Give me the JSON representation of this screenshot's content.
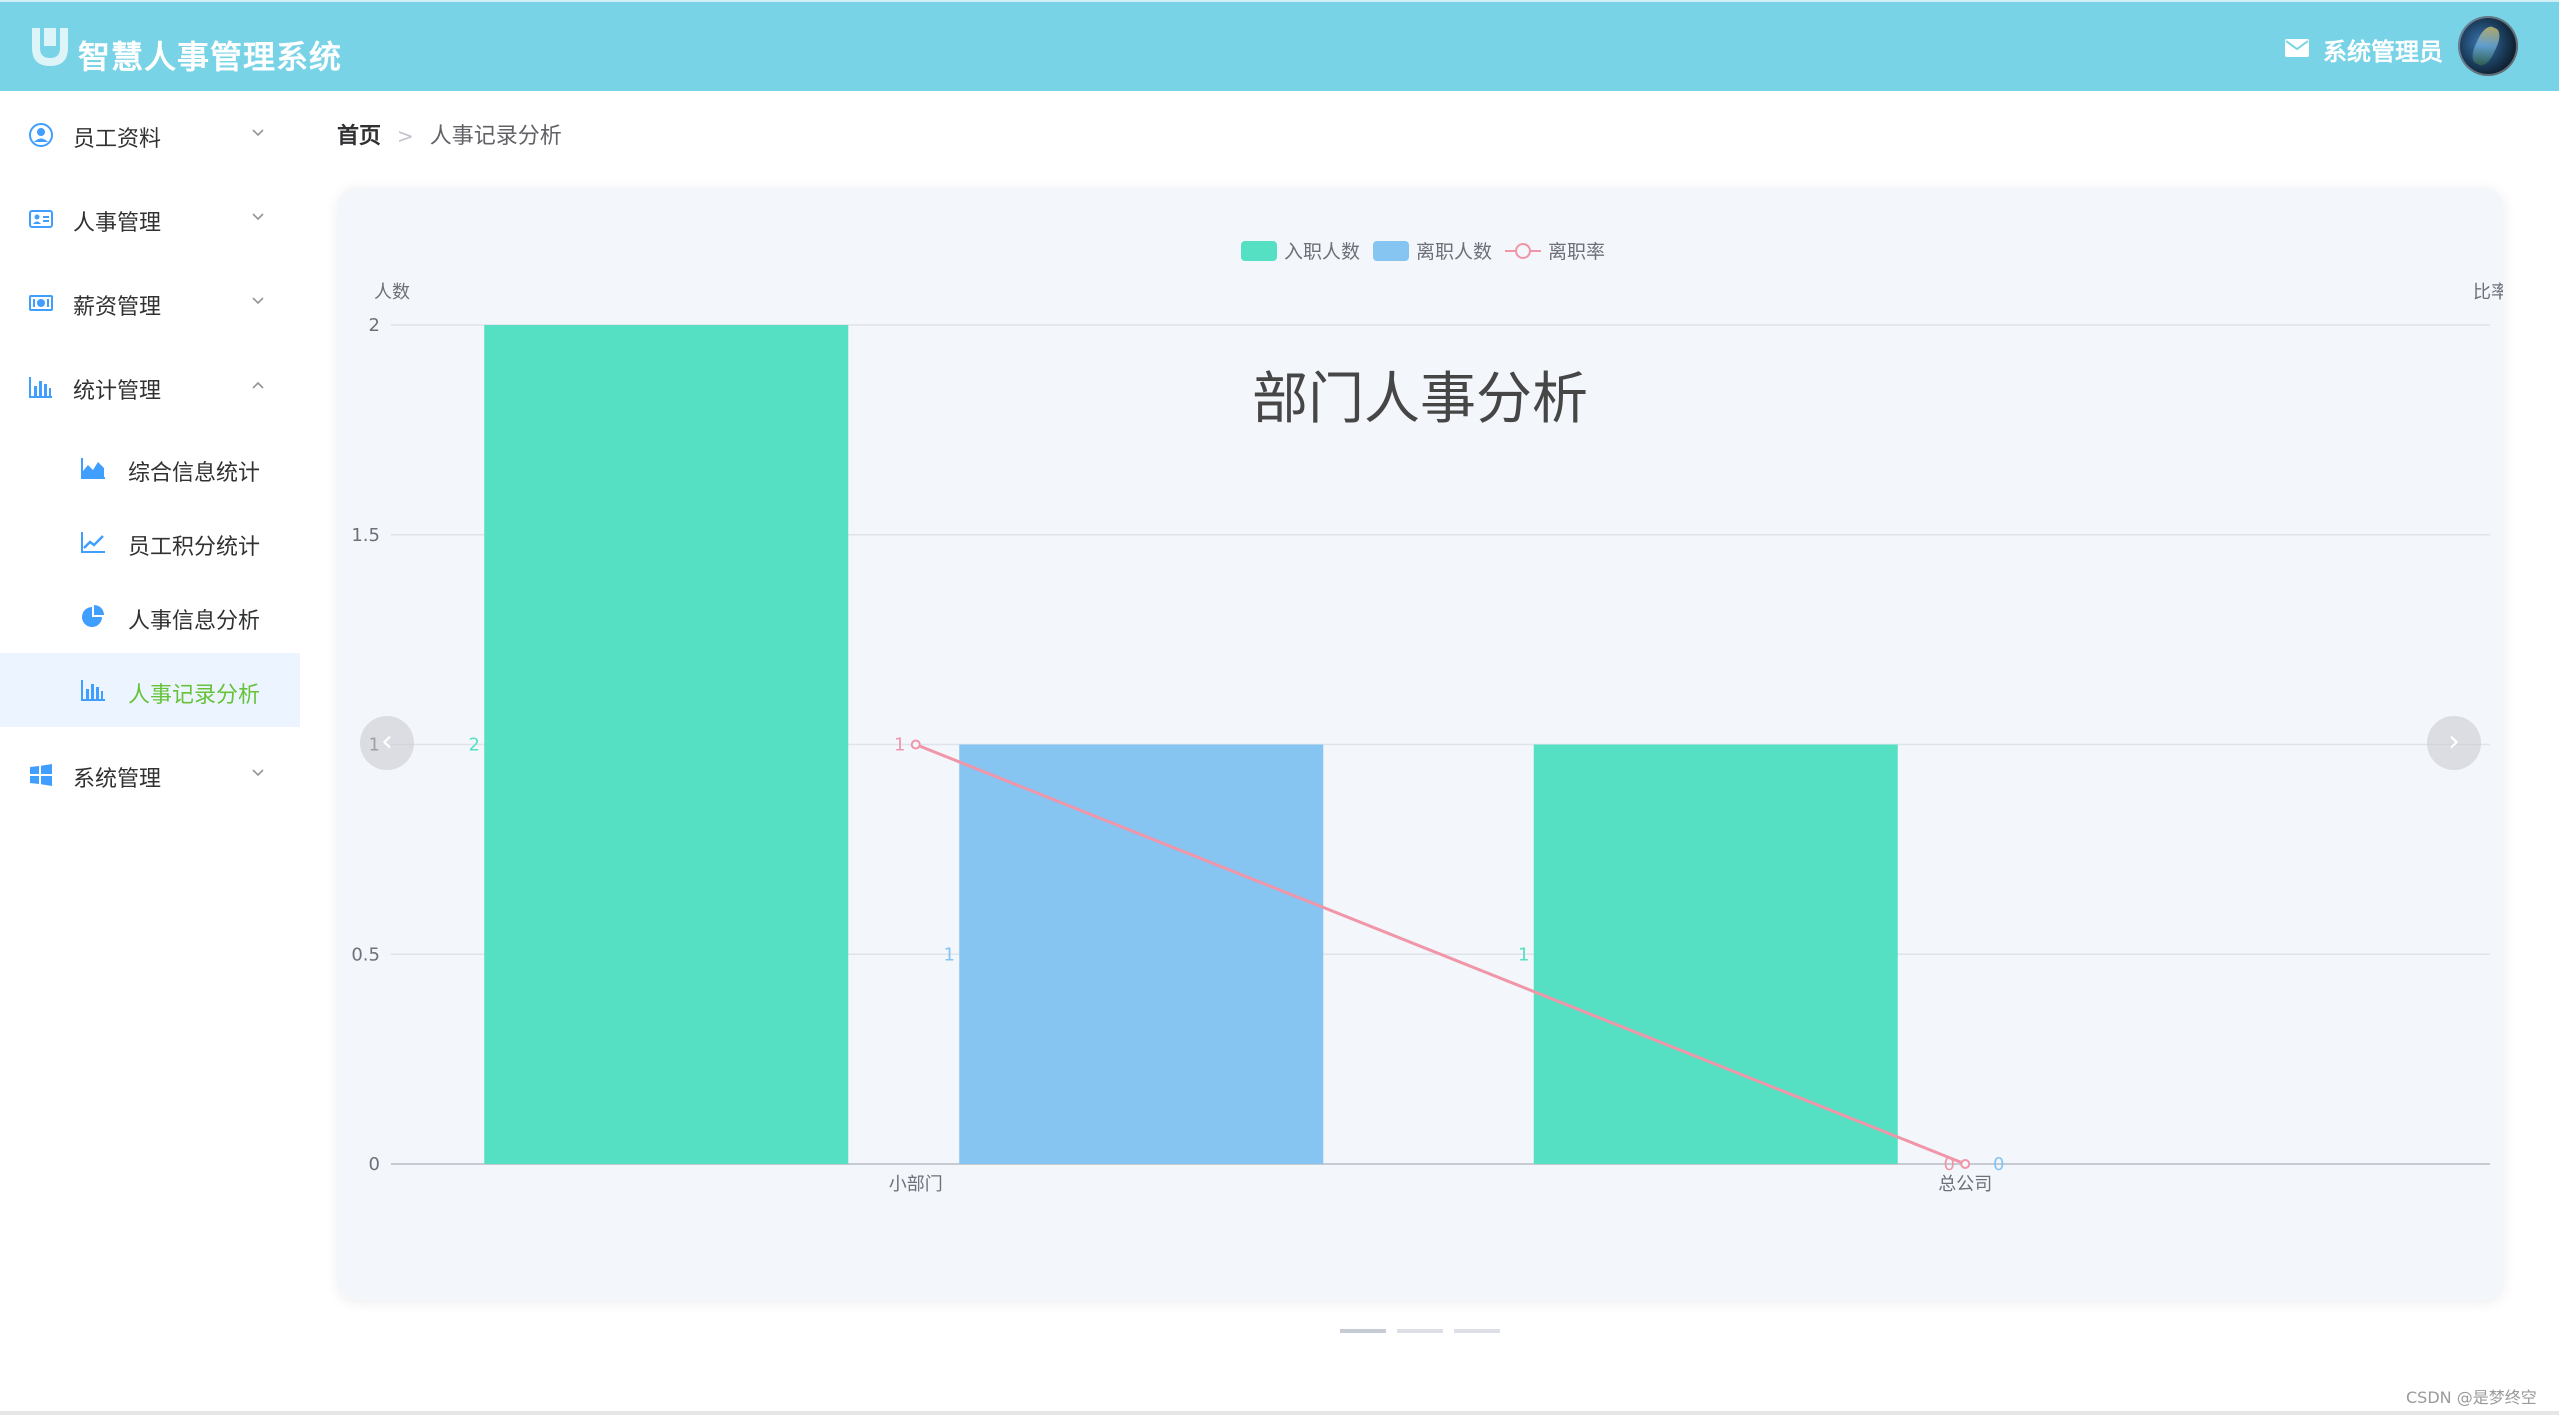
{
  "header": {
    "title": "智慧人事管理系统",
    "user": "系统管理员",
    "bg_color": "#78d3e6"
  },
  "sidebar": {
    "items": [
      {
        "label": "员工资料",
        "icon": "user-circle-icon",
        "expanded": false
      },
      {
        "label": "人事管理",
        "icon": "id-card-icon",
        "expanded": false
      },
      {
        "label": "薪资管理",
        "icon": "money-icon",
        "expanded": false
      },
      {
        "label": "统计管理",
        "icon": "bar-chart-icon",
        "expanded": true
      },
      {
        "label": "系统管理",
        "icon": "windows-icon",
        "expanded": false
      }
    ],
    "sub_items": [
      {
        "label": "综合信息统计",
        "icon": "area-chart-icon",
        "active": false
      },
      {
        "label": "员工积分统计",
        "icon": "line-chart-icon",
        "active": false
      },
      {
        "label": "人事信息分析",
        "icon": "pie-chart-icon",
        "active": false
      },
      {
        "label": "人事记录分析",
        "icon": "bar-chart-icon",
        "active": true
      }
    ]
  },
  "breadcrumb": {
    "home": "首页",
    "separator": ">",
    "current": "人事记录分析"
  },
  "carousel": {
    "prev": "‹",
    "next": "›",
    "indicator_count": 3,
    "active_index": 0
  },
  "chart_data": {
    "type": "bar",
    "title": "部门人事分析",
    "categories": [
      "小部门",
      "总公司"
    ],
    "series": [
      {
        "name": "入职人数",
        "type": "bar",
        "color": "#55e0c3",
        "values": [
          2,
          1
        ],
        "labels": [
          "2",
          "1"
        ]
      },
      {
        "name": "离职人数",
        "type": "bar",
        "color": "#86c4f2",
        "values": [
          1,
          0
        ],
        "labels": [
          "1",
          "0"
        ]
      },
      {
        "name": "离职率",
        "type": "line",
        "color": "#f096a8",
        "values": [
          1,
          0
        ],
        "labels": [
          "1",
          "0"
        ]
      }
    ],
    "ylabel": "人数",
    "y2label": "比率",
    "yticks": [
      "0",
      "0.5",
      "1",
      "1.5",
      "2"
    ],
    "ylim": [
      0,
      2
    ],
    "grid": true,
    "legend_position": "top-center"
  },
  "watermark": "CSDN @是梦终空"
}
